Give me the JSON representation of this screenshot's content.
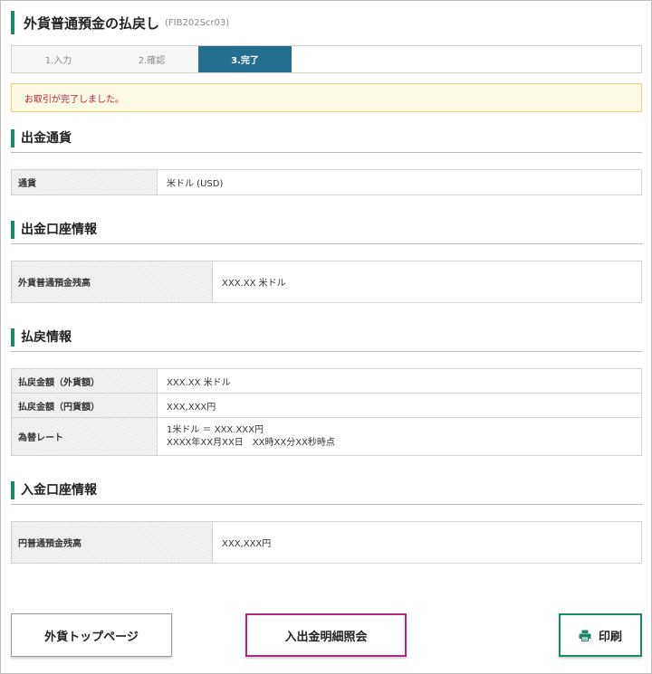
{
  "page": {
    "title": "外貨普通預金の払戻し",
    "screen_code": "(FIB202Scr03)"
  },
  "steps": [
    {
      "label": "1.入力"
    },
    {
      "label": "2.確認"
    },
    {
      "label": "3.完了"
    }
  ],
  "notice": "お取引が完了しました。",
  "sections": {
    "currency": {
      "title": "出金通貨",
      "rows": [
        {
          "label": "通貨",
          "value": "米ドル (USD)"
        }
      ]
    },
    "source_account": {
      "title": "出金口座情報",
      "rows": [
        {
          "label": "外貨普通預金残高",
          "value": "XXX.XX 米ドル"
        }
      ]
    },
    "withdrawal": {
      "title": "払戻情報",
      "rows": [
        {
          "label": "払戻金額（外貨額）",
          "value": "XXX.XX 米ドル"
        },
        {
          "label": "払戻金額（円貨額）",
          "value": "XXX,XXX円"
        },
        {
          "label": "為替レート",
          "value": "1米ドル ＝ XXX.XXX円",
          "value2": "XXXX年XX月XX日　XX時XX分XX秒時点"
        }
      ]
    },
    "dest_account": {
      "title": "入金口座情報",
      "rows": [
        {
          "label": "円普通預金残高",
          "value": "XXX,XXX円"
        }
      ]
    }
  },
  "buttons": {
    "fx_top": "外貨トップページ",
    "history": "入出金明細照会",
    "print": "印刷"
  },
  "colors": {
    "accent_green": "#1b8a6b",
    "active_step": "#246e92",
    "notice_text": "#c0163c",
    "history_border": "#b3267e"
  }
}
